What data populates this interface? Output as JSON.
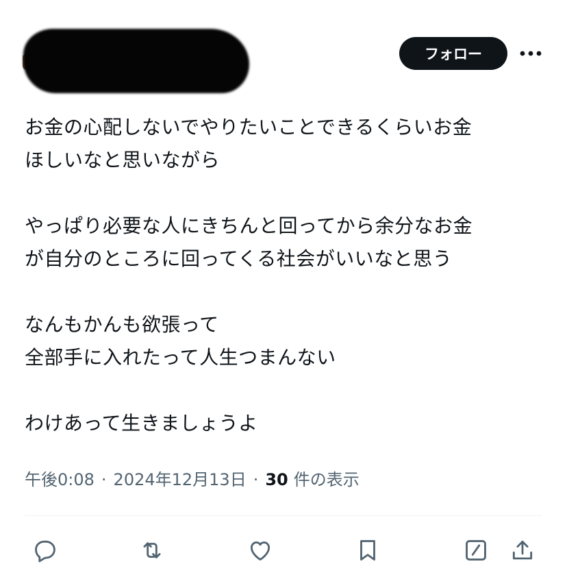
{
  "header": {
    "follow_label": "フォロー",
    "more_icon": "more-dots-icon"
  },
  "post": {
    "lines": [
      "お金の心配しないでやりたいことできるくらいお金",
      "ほしいなと思いながら",
      "",
      "やっぱり必要な人にきちんと回ってから余分なお金",
      "が自分のところに回ってくる社会がいいなと思う",
      "",
      "なんもかんも欲張って",
      "全部手に入れたって人生つまんない",
      "",
      "わけあって生きましょうよ"
    ]
  },
  "meta": {
    "time": "午後0:08",
    "separator": "·",
    "date": "2024年12月13日",
    "views_count": "30",
    "views_label": "件の表示"
  },
  "actions": [
    {
      "name": "reply-icon"
    },
    {
      "name": "repost-icon"
    },
    {
      "name": "like-icon"
    },
    {
      "name": "bookmark-icon"
    },
    {
      "name": "grok-icon"
    },
    {
      "name": "share-icon"
    }
  ],
  "colors": {
    "text": "#0f1419",
    "secondary": "#536471",
    "button_bg": "#0f1419",
    "button_text": "#ffffff"
  }
}
